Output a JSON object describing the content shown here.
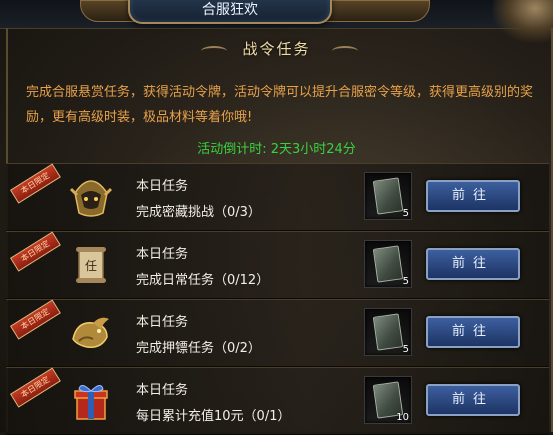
{
  "window": {
    "title": "合服狂欢"
  },
  "header": {
    "title": "战令任务"
  },
  "description": "完成合服悬赏任务，获得活动令牌，活动令牌可以提升合服密令等级，获得更高级别的奖励，更有高级时装，极品材料等着你哦!",
  "countdown": "活动倒计时: 2天3小时24分",
  "tasks": [
    {
      "badge": "本日限定",
      "icon": "golden-helmet-icon",
      "title": "本日任务",
      "desc": "完成密藏挑战（0/3）",
      "reward_icon": "token-tile-icon",
      "reward_count": "5",
      "button": "前往"
    },
    {
      "badge": "本日限定",
      "icon": "scroll-icon",
      "title": "本日任务",
      "desc": "完成日常任务（0/12）",
      "reward_icon": "token-tile-icon",
      "reward_count": "5",
      "button": "前往"
    },
    {
      "badge": "本日限定",
      "icon": "golden-dragon-icon",
      "title": "本日任务",
      "desc": "完成押镖任务（0/2）",
      "reward_icon": "token-tile-icon",
      "reward_count": "5",
      "button": "前往"
    },
    {
      "badge": "本日限定",
      "icon": "gift-box-icon",
      "title": "本日任务",
      "desc": "每日累计充值10元（0/1）",
      "reward_icon": "token-tile-icon",
      "reward_count": "10",
      "button": "前往"
    }
  ],
  "colors": {
    "description_text": "#e8a24a",
    "countdown_text": "#39d23f",
    "button_bg": "#2b4a86",
    "ribbon_red": "#b3301b"
  }
}
